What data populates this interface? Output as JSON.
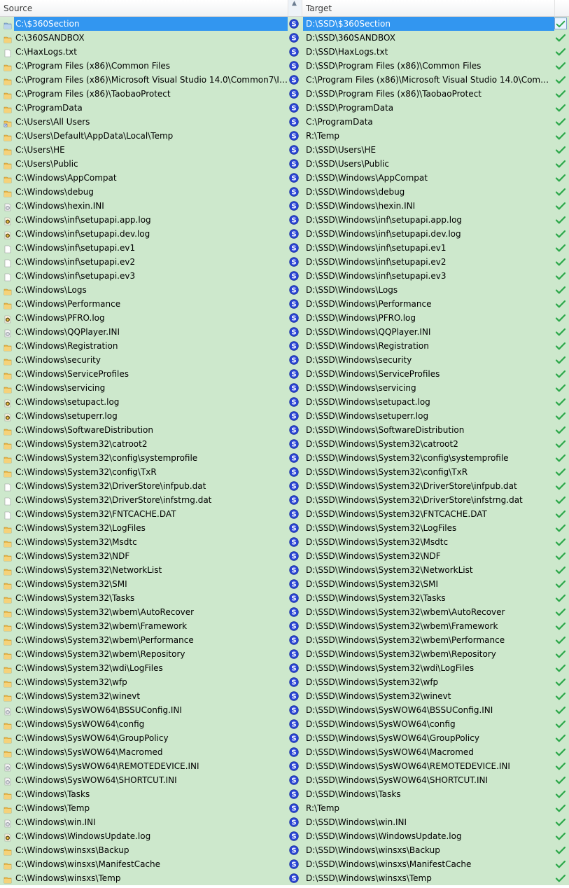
{
  "columns": {
    "source": "Source",
    "target": "Target"
  },
  "rows": [
    {
      "source": "C:\\$360Section",
      "target": "D:\\SSD\\$360Section",
      "icon": "drive-folder-icon"
    },
    {
      "source": "C:\\360SANDBOX",
      "target": "D:\\SSD\\360SANDBOX",
      "icon": "folder-icon"
    },
    {
      "source": "C:\\HaxLogs.txt",
      "target": "D:\\SSD\\HaxLogs.txt",
      "icon": "text-file-icon"
    },
    {
      "source": "C:\\Program Files (x86)\\Common Files",
      "target": "D:\\SSD\\Program Files (x86)\\Common Files",
      "icon": "folder-icon"
    },
    {
      "source": "C:\\Program Files (x86)\\Microsoft Visual Studio 14.0\\Common7\\ID...",
      "target": "C:\\Program Files (x86)\\Microsoft Visual Studio 14.0\\Comm...",
      "icon": "folder-icon"
    },
    {
      "source": "C:\\Program Files (x86)\\TaobaoProtect",
      "target": "D:\\SSD\\Program Files (x86)\\TaobaoProtect",
      "icon": "folder-icon"
    },
    {
      "source": "C:\\ProgramData",
      "target": "D:\\SSD\\ProgramData",
      "icon": "folder-icon"
    },
    {
      "source": "C:\\Users\\All Users",
      "target": "C:\\ProgramData",
      "icon": "shortcut-folder-icon"
    },
    {
      "source": "C:\\Users\\Default\\AppData\\Local\\Temp",
      "target": "R:\\Temp",
      "icon": "folder-icon"
    },
    {
      "source": "C:\\Users\\HE",
      "target": "D:\\SSD\\Users\\HE",
      "icon": "folder-icon"
    },
    {
      "source": "C:\\Users\\Public",
      "target": "D:\\SSD\\Users\\Public",
      "icon": "folder-icon"
    },
    {
      "source": "C:\\Windows\\AppCompat",
      "target": "D:\\SSD\\Windows\\AppCompat",
      "icon": "folder-icon"
    },
    {
      "source": "C:\\Windows\\debug",
      "target": "D:\\SSD\\Windows\\debug",
      "icon": "folder-icon"
    },
    {
      "source": "C:\\Windows\\hexin.INI",
      "target": "D:\\SSD\\Windows\\hexin.INI",
      "icon": "ini-file-icon"
    },
    {
      "source": "C:\\Windows\\inf\\setupapi.app.log",
      "target": "D:\\SSD\\Windows\\inf\\setupapi.app.log",
      "icon": "log-file-icon"
    },
    {
      "source": "C:\\Windows\\inf\\setupapi.dev.log",
      "target": "D:\\SSD\\Windows\\inf\\setupapi.dev.log",
      "icon": "log-file-icon"
    },
    {
      "source": "C:\\Windows\\inf\\setupapi.ev1",
      "target": "D:\\SSD\\Windows\\inf\\setupapi.ev1",
      "icon": "text-file-icon"
    },
    {
      "source": "C:\\Windows\\inf\\setupapi.ev2",
      "target": "D:\\SSD\\Windows\\inf\\setupapi.ev2",
      "icon": "text-file-icon"
    },
    {
      "source": "C:\\Windows\\inf\\setupapi.ev3",
      "target": "D:\\SSD\\Windows\\inf\\setupapi.ev3",
      "icon": "text-file-icon"
    },
    {
      "source": "C:\\Windows\\Logs",
      "target": "D:\\SSD\\Windows\\Logs",
      "icon": "folder-icon"
    },
    {
      "source": "C:\\Windows\\Performance",
      "target": "D:\\SSD\\Windows\\Performance",
      "icon": "folder-icon"
    },
    {
      "source": "C:\\Windows\\PFRO.log",
      "target": "D:\\SSD\\Windows\\PFRO.log",
      "icon": "log-file-icon"
    },
    {
      "source": "C:\\Windows\\QQPlayer.INI",
      "target": "D:\\SSD\\Windows\\QQPlayer.INI",
      "icon": "ini-file-icon"
    },
    {
      "source": "C:\\Windows\\Registration",
      "target": "D:\\SSD\\Windows\\Registration",
      "icon": "folder-icon"
    },
    {
      "source": "C:\\Windows\\security",
      "target": "D:\\SSD\\Windows\\security",
      "icon": "folder-icon"
    },
    {
      "source": "C:\\Windows\\ServiceProfiles",
      "target": "D:\\SSD\\Windows\\ServiceProfiles",
      "icon": "folder-icon"
    },
    {
      "source": "C:\\Windows\\servicing",
      "target": "D:\\SSD\\Windows\\servicing",
      "icon": "folder-icon"
    },
    {
      "source": "C:\\Windows\\setupact.log",
      "target": "D:\\SSD\\Windows\\setupact.log",
      "icon": "log-file-icon"
    },
    {
      "source": "C:\\Windows\\setuperr.log",
      "target": "D:\\SSD\\Windows\\setuperr.log",
      "icon": "log-file-icon"
    },
    {
      "source": "C:\\Windows\\SoftwareDistribution",
      "target": "D:\\SSD\\Windows\\SoftwareDistribution",
      "icon": "folder-icon"
    },
    {
      "source": "C:\\Windows\\System32\\catroot2",
      "target": "D:\\SSD\\Windows\\System32\\catroot2",
      "icon": "folder-icon"
    },
    {
      "source": "C:\\Windows\\System32\\config\\systemprofile",
      "target": "D:\\SSD\\Windows\\System32\\config\\systemprofile",
      "icon": "folder-icon"
    },
    {
      "source": "C:\\Windows\\System32\\config\\TxR",
      "target": "D:\\SSD\\Windows\\System32\\config\\TxR",
      "icon": "folder-icon"
    },
    {
      "source": "C:\\Windows\\System32\\DriverStore\\infpub.dat",
      "target": "D:\\SSD\\Windows\\System32\\DriverStore\\infpub.dat",
      "icon": "text-file-icon"
    },
    {
      "source": "C:\\Windows\\System32\\DriverStore\\infstrng.dat",
      "target": "D:\\SSD\\Windows\\System32\\DriverStore\\infstrng.dat",
      "icon": "text-file-icon"
    },
    {
      "source": "C:\\Windows\\System32\\FNTCACHE.DAT",
      "target": "D:\\SSD\\Windows\\System32\\FNTCACHE.DAT",
      "icon": "text-file-icon"
    },
    {
      "source": "C:\\Windows\\System32\\LogFiles",
      "target": "D:\\SSD\\Windows\\System32\\LogFiles",
      "icon": "folder-icon"
    },
    {
      "source": "C:\\Windows\\System32\\Msdtc",
      "target": "D:\\SSD\\Windows\\System32\\Msdtc",
      "icon": "folder-icon"
    },
    {
      "source": "C:\\Windows\\System32\\NDF",
      "target": "D:\\SSD\\Windows\\System32\\NDF",
      "icon": "folder-icon"
    },
    {
      "source": "C:\\Windows\\System32\\NetworkList",
      "target": "D:\\SSD\\Windows\\System32\\NetworkList",
      "icon": "folder-icon"
    },
    {
      "source": "C:\\Windows\\System32\\SMI",
      "target": "D:\\SSD\\Windows\\System32\\SMI",
      "icon": "folder-icon"
    },
    {
      "source": "C:\\Windows\\System32\\Tasks",
      "target": "D:\\SSD\\Windows\\System32\\Tasks",
      "icon": "folder-icon"
    },
    {
      "source": "C:\\Windows\\System32\\wbem\\AutoRecover",
      "target": "D:\\SSD\\Windows\\System32\\wbem\\AutoRecover",
      "icon": "folder-icon"
    },
    {
      "source": "C:\\Windows\\System32\\wbem\\Framework",
      "target": "D:\\SSD\\Windows\\System32\\wbem\\Framework",
      "icon": "folder-icon"
    },
    {
      "source": "C:\\Windows\\System32\\wbem\\Performance",
      "target": "D:\\SSD\\Windows\\System32\\wbem\\Performance",
      "icon": "folder-icon"
    },
    {
      "source": "C:\\Windows\\System32\\wbem\\Repository",
      "target": "D:\\SSD\\Windows\\System32\\wbem\\Repository",
      "icon": "folder-icon"
    },
    {
      "source": "C:\\Windows\\System32\\wdi\\LogFiles",
      "target": "D:\\SSD\\Windows\\System32\\wdi\\LogFiles",
      "icon": "folder-icon"
    },
    {
      "source": "C:\\Windows\\System32\\wfp",
      "target": "D:\\SSD\\Windows\\System32\\wfp",
      "icon": "folder-icon"
    },
    {
      "source": "C:\\Windows\\System32\\winevt",
      "target": "D:\\SSD\\Windows\\System32\\winevt",
      "icon": "folder-icon"
    },
    {
      "source": "C:\\Windows\\SysWOW64\\BSSUConfig.INI",
      "target": "D:\\SSD\\Windows\\SysWOW64\\BSSUConfig.INI",
      "icon": "ini-file-icon"
    },
    {
      "source": "C:\\Windows\\SysWOW64\\config",
      "target": "D:\\SSD\\Windows\\SysWOW64\\config",
      "icon": "folder-icon"
    },
    {
      "source": "C:\\Windows\\SysWOW64\\GroupPolicy",
      "target": "D:\\SSD\\Windows\\SysWOW64\\GroupPolicy",
      "icon": "folder-icon"
    },
    {
      "source": "C:\\Windows\\SysWOW64\\Macromed",
      "target": "D:\\SSD\\Windows\\SysWOW64\\Macromed",
      "icon": "folder-icon"
    },
    {
      "source": "C:\\Windows\\SysWOW64\\REMOTEDEVICE.INI",
      "target": "D:\\SSD\\Windows\\SysWOW64\\REMOTEDEVICE.INI",
      "icon": "ini-file-icon"
    },
    {
      "source": "C:\\Windows\\SysWOW64\\SHORTCUT.INI",
      "target": "D:\\SSD\\Windows\\SysWOW64\\SHORTCUT.INI",
      "icon": "ini-file-icon"
    },
    {
      "source": "C:\\Windows\\Tasks",
      "target": "D:\\SSD\\Windows\\Tasks",
      "icon": "folder-icon"
    },
    {
      "source": "C:\\Windows\\Temp",
      "target": "R:\\Temp",
      "icon": "folder-icon"
    },
    {
      "source": "C:\\Windows\\win.INI",
      "target": "D:\\SSD\\Windows\\win.INI",
      "icon": "ini-file-icon"
    },
    {
      "source": "C:\\Windows\\WindowsUpdate.log",
      "target": "D:\\SSD\\Windows\\WindowsUpdate.log",
      "icon": "log-file-icon"
    },
    {
      "source": "C:\\Windows\\winsxs\\Backup",
      "target": "D:\\SSD\\Windows\\winsxs\\Backup",
      "icon": "folder-icon"
    },
    {
      "source": "C:\\Windows\\winsxs\\ManifestCache",
      "target": "D:\\SSD\\Windows\\winsxs\\ManifestCache",
      "icon": "folder-icon"
    },
    {
      "source": "C:\\Windows\\winsxs\\Temp",
      "target": "D:\\SSD\\Windows\\winsxs\\Temp",
      "icon": "folder-icon"
    }
  ],
  "selected_index": 0,
  "colors": {
    "row_bg": "#cde8cc",
    "selection": "#3296f0",
    "check": "#2ca84a",
    "link_icon": "#2a45d6"
  }
}
